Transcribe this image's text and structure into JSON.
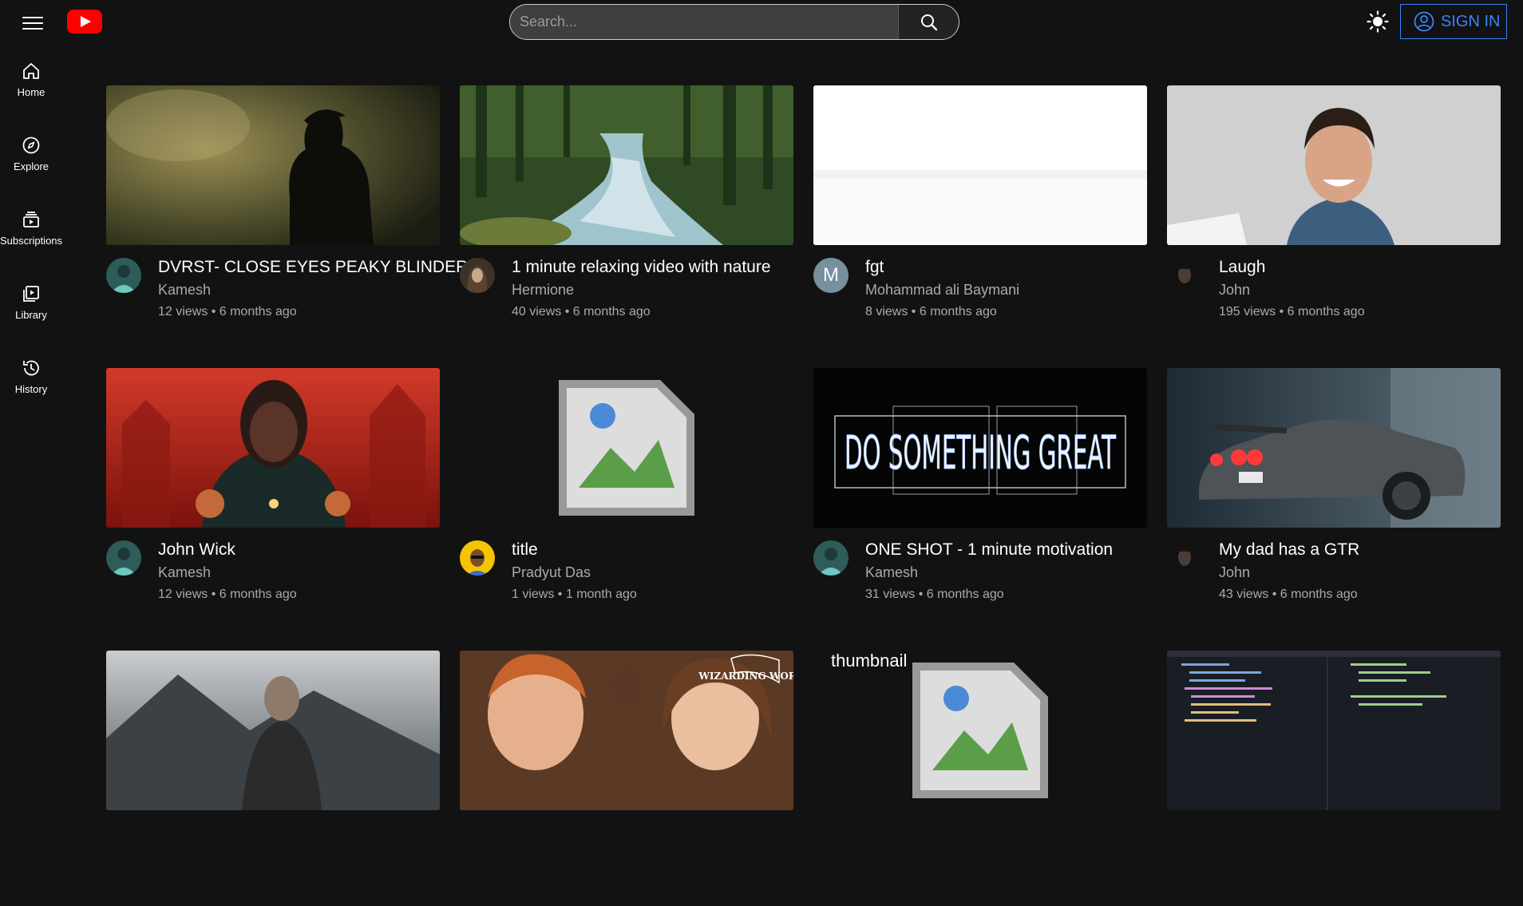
{
  "header": {
    "search_placeholder": "Search...",
    "signin_label": "SIGN IN",
    "brand_color": "#ff0000",
    "accent_color": "#3b82f6"
  },
  "sidebar": {
    "items": [
      {
        "label": "Home",
        "icon": "home-icon"
      },
      {
        "label": "Explore",
        "icon": "compass-icon"
      },
      {
        "label": "Subscriptions",
        "icon": "subscriptions-icon"
      },
      {
        "label": "Library",
        "icon": "library-icon"
      },
      {
        "label": "History",
        "icon": "history-icon"
      }
    ]
  },
  "videos": [
    {
      "title": "DVRST- CLOSE EYES PEAKY BLINDERS",
      "channel": "Kamesh",
      "stats": "12 views • 6 months ago",
      "thumb": "peaky",
      "avatar": "kamesh"
    },
    {
      "title": "1 minute relaxing video with nature",
      "channel": "Hermione",
      "stats": "40 views • 6 months ago",
      "thumb": "river",
      "avatar": "hermione"
    },
    {
      "title": "fgt",
      "channel": "Mohammad ali Baymani",
      "stats": "8 views • 6 months ago",
      "thumb": "blank",
      "avatar": "letter",
      "avatar_letter": "M"
    },
    {
      "title": "Laugh",
      "channel": "John",
      "stats": "195 views • 6 months ago",
      "thumb": "laugh",
      "avatar": "john"
    },
    {
      "title": "John Wick",
      "channel": "Kamesh",
      "stats": "12 views • 6 months ago",
      "thumb": "wick",
      "avatar": "kamesh"
    },
    {
      "title": "title",
      "channel": "Pradyut Das",
      "stats": "1 views • 1 month ago",
      "thumb": "broken",
      "avatar": "pradyut"
    },
    {
      "title": "ONE SHOT - 1 minute motivation",
      "channel": "Kamesh",
      "stats": "31 views • 6 months ago",
      "thumb": "neon",
      "avatar": "kamesh",
      "neon_text": "DO SOMETHING GREAT"
    },
    {
      "title": "My dad has a GTR",
      "channel": "John",
      "stats": "43 views • 6 months ago",
      "thumb": "gtr",
      "avatar": "john"
    },
    {
      "title": "",
      "channel": "",
      "stats": "",
      "thumb": "viking",
      "avatar": ""
    },
    {
      "title": "",
      "channel": "",
      "stats": "",
      "thumb": "wizarding",
      "avatar": "",
      "badge": "WIZARDING WORLD"
    },
    {
      "title": "",
      "channel": "",
      "stats": "",
      "thumb": "broken-alt",
      "avatar": "",
      "alt": "thumbnail"
    },
    {
      "title": "",
      "channel": "",
      "stats": "",
      "thumb": "code",
      "avatar": ""
    }
  ]
}
